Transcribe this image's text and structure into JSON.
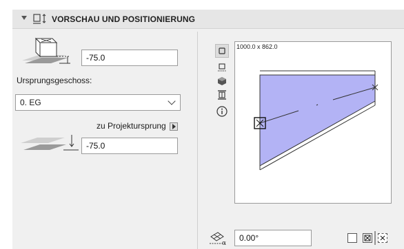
{
  "header": {
    "title": "VORSCHAU UND POSITIONIERUNG"
  },
  "left": {
    "offset_top_value": "-75.0",
    "home_story_label": "Ursprungsgeschoss:",
    "home_story_value": "0. EG",
    "to_project_zero_label": "zu Projektursprung",
    "offset_bottom_value": "-75.0"
  },
  "preview": {
    "dimensions": "1000.0 x 862.0",
    "angle_value": "0.00°",
    "tools": [
      "plan-view-icon",
      "section-view-icon",
      "3d-view-icon",
      "elevation-view-icon",
      "info-icon"
    ]
  },
  "colors": {
    "preview_fill": "#b3b3f5",
    "header_bg": "#e6e6e6"
  }
}
